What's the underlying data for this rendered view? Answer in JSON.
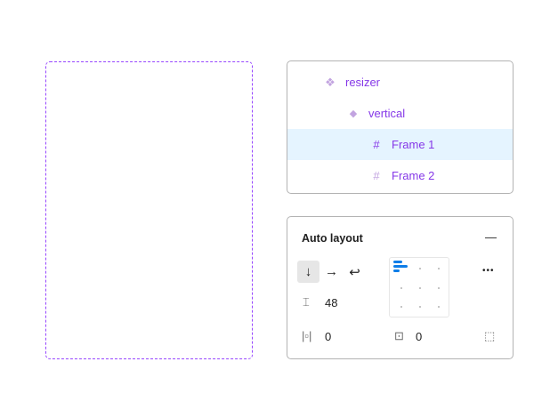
{
  "layers": [
    {
      "name": "resizer",
      "icon": "component-set-icon",
      "glyph": "❖",
      "selected": false
    },
    {
      "name": "vertical",
      "icon": "component-instance-icon",
      "glyph": "◆",
      "selected": false
    },
    {
      "name": "Frame 1",
      "icon": "frame-icon",
      "glyph": "#",
      "selected": true
    },
    {
      "name": "Frame 2",
      "icon": "frame-icon",
      "glyph": "#",
      "selected": false
    }
  ],
  "auto_layout": {
    "title": "Auto layout",
    "remove_glyph": "—",
    "direction_vertical": "↓",
    "direction_horizontal": "→",
    "direction_wrap": "↩",
    "more": "•••",
    "gap": "48",
    "horizontal_padding": "0",
    "vertical_padding": "0"
  },
  "colors": {
    "accent": "#9747ff",
    "selection": "#e5f4ff",
    "alignment": "#0d7de8"
  }
}
